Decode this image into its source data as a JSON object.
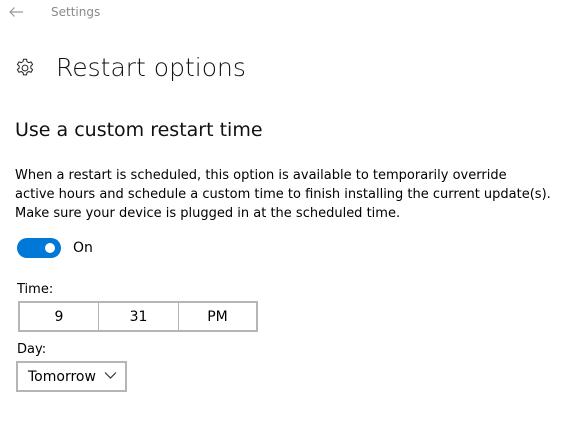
{
  "titlebar": {
    "app_title": "Settings",
    "back_icon": "arrow-left-icon"
  },
  "header": {
    "icon": "gear-icon",
    "title": "Restart options"
  },
  "section": {
    "title": "Use a custom restart time",
    "description_lines": [
      "When a restart is scheduled, this option is available to temporarily override",
      "active hours and schedule a custom time to finish installing the current update(s).",
      "Make sure your device is plugged in at the scheduled time."
    ]
  },
  "toggle": {
    "state": "on",
    "label": "On",
    "accent_color": "#0078d7"
  },
  "time": {
    "label": "Time:",
    "hour": "9",
    "minute": "31",
    "period": "PM"
  },
  "day": {
    "label": "Day:",
    "selected": "Tomorrow",
    "icon": "chevron-down-icon"
  }
}
